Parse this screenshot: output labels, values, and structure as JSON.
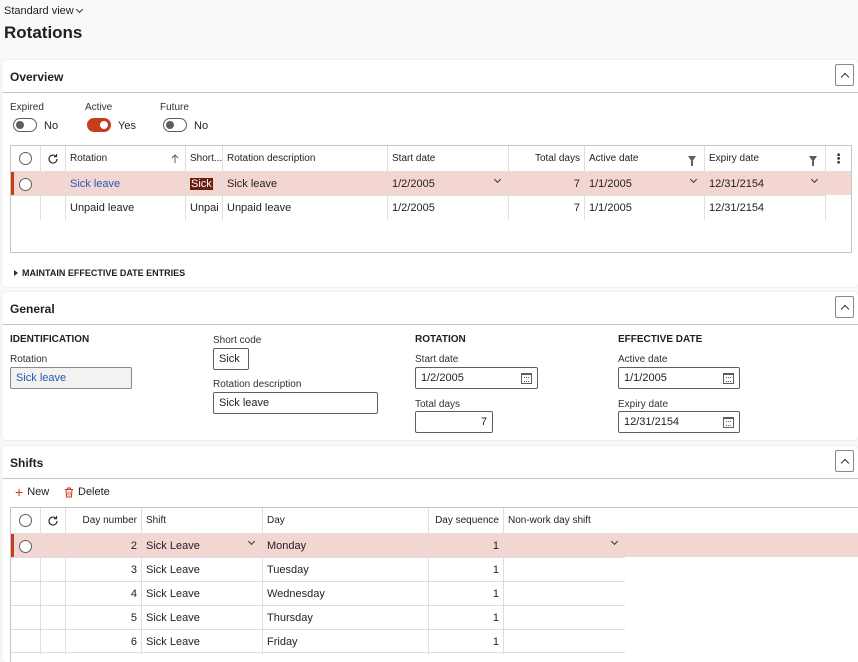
{
  "header": {
    "view_label": "Standard view",
    "page_title": "Rotations"
  },
  "overview": {
    "title": "Overview",
    "toggles": [
      {
        "label": "Expired",
        "value": "No",
        "on": false
      },
      {
        "label": "Active",
        "value": "Yes",
        "on": true
      },
      {
        "label": "Future",
        "value": "No",
        "on": false
      }
    ],
    "columns": {
      "rotation": "Rotation",
      "short": "Short...",
      "description": "Rotation description",
      "start": "Start date",
      "total": "Total days",
      "active": "Active date",
      "expiry": "Expiry date"
    },
    "rows": [
      {
        "rotation": "Sick leave",
        "short": "Sick",
        "description": "Sick leave",
        "start": "1/2/2005",
        "total": "7",
        "active": "1/1/2005",
        "expiry": "12/31/2154"
      },
      {
        "rotation": "Unpaid leave",
        "short": "Unpai",
        "description": "Unpaid leave",
        "start": "1/2/2005",
        "total": "7",
        "active": "1/1/2005",
        "expiry": "12/31/2154"
      }
    ],
    "maintain_label": "MAINTAIN EFFECTIVE DATE ENTRIES"
  },
  "general": {
    "title": "General",
    "identification": {
      "title": "IDENTIFICATION",
      "rotation_label": "Rotation",
      "rotation_value": "Sick leave"
    },
    "short_code": {
      "label": "Short code",
      "value": "Sick"
    },
    "description": {
      "label": "Rotation description",
      "value": "Sick leave"
    },
    "rotation": {
      "title": "ROTATION",
      "start_label": "Start date",
      "start_value": "1/2/2005",
      "total_label": "Total days",
      "total_value": "7"
    },
    "effective": {
      "title": "EFFECTIVE DATE",
      "active_label": "Active date",
      "active_value": "1/1/2005",
      "expiry_label": "Expiry date",
      "expiry_value": "12/31/2154"
    }
  },
  "shifts": {
    "title": "Shifts",
    "new_label": "New",
    "delete_label": "Delete",
    "columns": {
      "day_number": "Day number",
      "shift": "Shift",
      "day": "Day",
      "day_sequence": "Day sequence",
      "non_work": "Non-work day shift"
    },
    "rows": [
      {
        "day_number": "2",
        "shift": "Sick Leave",
        "day": "Monday",
        "day_sequence": "1",
        "non_work": ""
      },
      {
        "day_number": "3",
        "shift": "Sick Leave",
        "day": "Tuesday",
        "day_sequence": "1",
        "non_work": ""
      },
      {
        "day_number": "4",
        "shift": "Sick Leave",
        "day": "Wednesday",
        "day_sequence": "1",
        "non_work": ""
      },
      {
        "day_number": "5",
        "shift": "Sick Leave",
        "day": "Thursday",
        "day_sequence": "1",
        "non_work": ""
      },
      {
        "day_number": "6",
        "shift": "Sick Leave",
        "day": "Friday",
        "day_sequence": "1",
        "non_work": ""
      }
    ]
  },
  "colors": {
    "accent": "#c43e1c",
    "selected_row": "#f3d6d1",
    "link": "#1e5bb8"
  }
}
